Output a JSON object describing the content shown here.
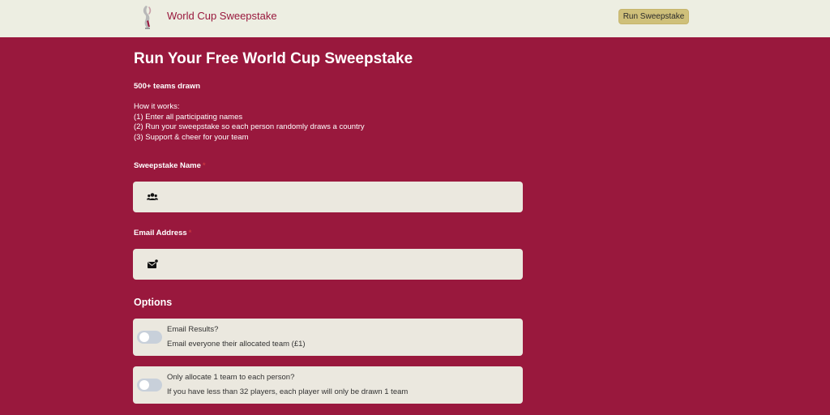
{
  "header": {
    "brand": "World Cup Sweepstake",
    "cta_label": "Run Sweepstake"
  },
  "main": {
    "title": "Run Your Free World Cup Sweepstake",
    "stat": "500+ teams drawn",
    "how_heading": "How it works:",
    "steps": [
      "(1) Enter all participating names",
      "(2) Run your sweepstake so each person randomly draws a country",
      "(3) Support & cheer for your team"
    ]
  },
  "form": {
    "name_label": "Sweepstake Name",
    "name_value": "",
    "email_label": "Email Address",
    "email_value": "",
    "required_mark": "*"
  },
  "options": {
    "heading": "Options",
    "items": [
      {
        "question": "Email Results?",
        "description": "Email everyone their allocated team (£1)",
        "enabled": false
      },
      {
        "question": "Only allocate 1 team to each person?",
        "description": "If you have less than 32 players, each player will only be drawn 1 team",
        "enabled": false
      }
    ]
  },
  "icons": {
    "logo": "trophy-logo",
    "name_field": "users-icon",
    "email_field": "envelope-icon"
  },
  "colors": {
    "background": "#99183d",
    "header_bg": "#edeee2",
    "button_bg": "#cfc07a",
    "field_bg": "#ebe8df",
    "toggle_off": "#c8d0da"
  }
}
